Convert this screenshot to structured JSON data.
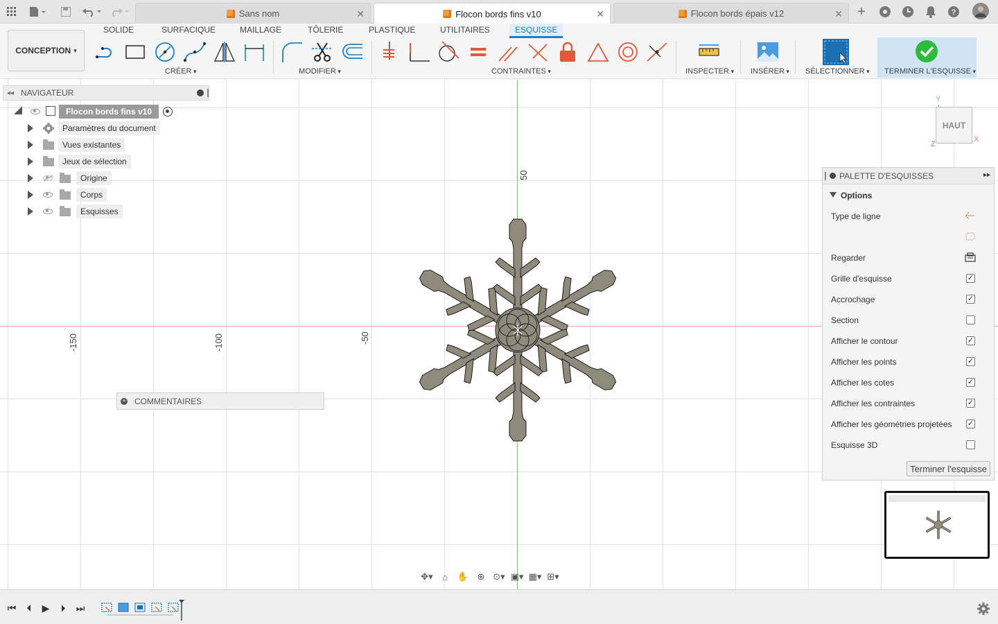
{
  "tabs": [
    {
      "label": "Sans nom",
      "active": false
    },
    {
      "label": "Flocon bords fins v10",
      "active": true
    },
    {
      "label": "Flocon bords épais v12",
      "active": false
    }
  ],
  "ribbon": {
    "workspace": "CONCEPTION",
    "tabs": [
      "SOLIDE",
      "SURFACIQUE",
      "MAILLAGE",
      "TÔLERIE",
      "PLASTIQUE",
      "UTILITAIRES",
      "ESQUISSE"
    ],
    "active_tab": "ESQUISSE",
    "groups": {
      "create": "CRÉER",
      "modify": "MODIFIER",
      "constraints": "CONTRAINTES",
      "inspect": "INSPECTER",
      "insert": "INSÉRER",
      "select": "SÉLECTIONNER",
      "finish": "TERMINER L'ESQUISSE"
    }
  },
  "navigator": {
    "title": "NAVIGATEUR",
    "root": "Flocon bords fins v10",
    "items": [
      {
        "label": "Paramètres du document"
      },
      {
        "label": "Vues existantes"
      },
      {
        "label": "Jeux de sélection"
      },
      {
        "label": "Origine"
      },
      {
        "label": "Corps"
      },
      {
        "label": "Esquisses"
      }
    ]
  },
  "canvas": {
    "ticks": {
      "t50v": "50",
      "tm150": "-150",
      "tm100": "-100",
      "tm50": "-50"
    },
    "viewcube": {
      "face": "HAUT",
      "x": "X",
      "y": "Y",
      "z": "Z"
    },
    "comments": "COMMENTAIRES"
  },
  "palette": {
    "title": "PALETTE D'ESQUISSES",
    "section": "Options",
    "rows": [
      {
        "label": "Type de ligne",
        "kind": "icon"
      },
      {
        "label": "",
        "kind": "icon"
      },
      {
        "label": "Regarder",
        "kind": "icon"
      },
      {
        "label": "Grille d'esquisse",
        "kind": "check",
        "checked": true
      },
      {
        "label": "Accrochage",
        "kind": "check",
        "checked": true
      },
      {
        "label": "Section",
        "kind": "check",
        "checked": false
      },
      {
        "label": "Afficher le contour",
        "kind": "check",
        "checked": true
      },
      {
        "label": "Afficher les points",
        "kind": "check",
        "checked": true
      },
      {
        "label": "Afficher les cotes",
        "kind": "check",
        "checked": true
      },
      {
        "label": "Afficher les contraintes",
        "kind": "check",
        "checked": true
      },
      {
        "label": "Afficher les géométries projetées",
        "kind": "check",
        "checked": true
      },
      {
        "label": "Esquisse 3D",
        "kind": "check",
        "checked": false
      }
    ],
    "finish_button": "Terminer l'esquisse"
  },
  "colors": {
    "accent": "#1b7fd0",
    "snowflake_fill": "#8f8a7c",
    "axis_x": "#f0a0a0",
    "axis_y": "#7cc57c",
    "finish_check": "#2dbb3c"
  }
}
